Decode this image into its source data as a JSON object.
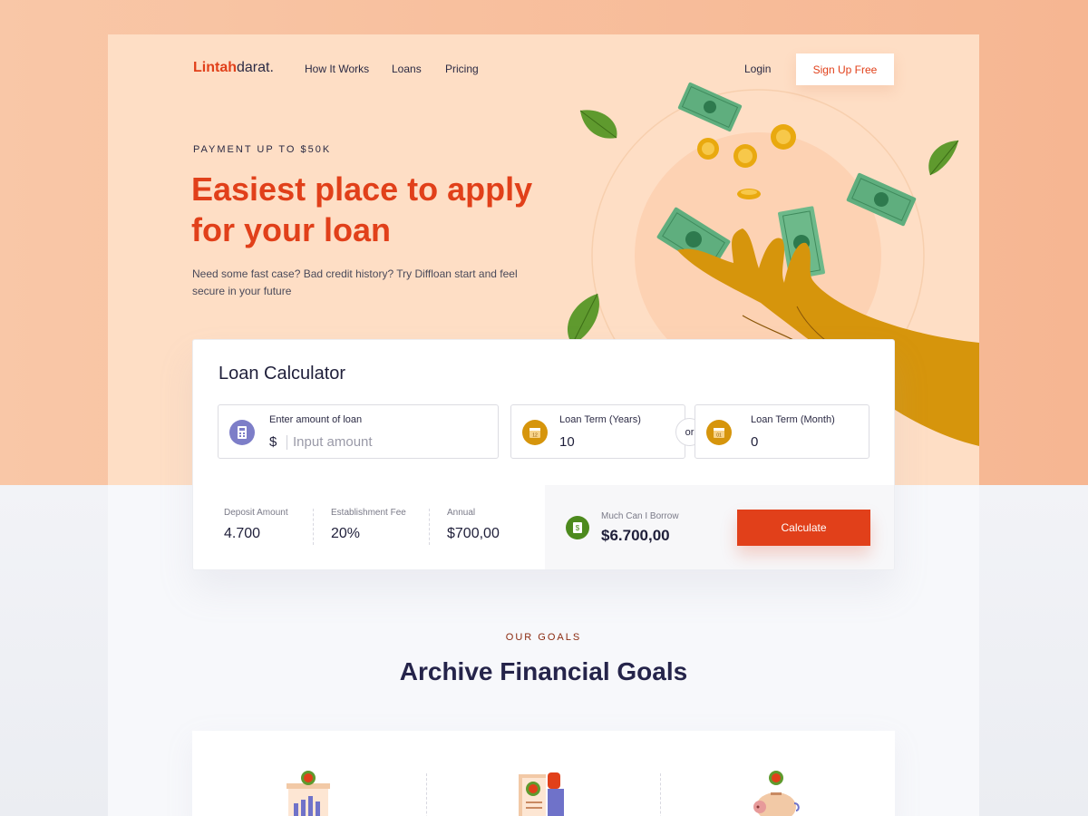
{
  "brand": {
    "first": "Lintah",
    "rest": "darat."
  },
  "nav": {
    "links": [
      "How It Works",
      "Loans",
      "Pricing"
    ],
    "login": "Login",
    "signup": "Sign Up Free"
  },
  "hero": {
    "eyebrow": "PAYMENT UP TO $50K",
    "headline_line1": "Easiest place to apply",
    "headline_line2": "for your loan",
    "subtitle": "Need some fast case? Bad credit history? Try Diffloan start and feel secure in your future"
  },
  "calculator": {
    "title": "Loan Calculator",
    "amount": {
      "label": "Enter amount of loan",
      "currency": "$",
      "placeholder": "Input amount"
    },
    "term_years": {
      "label": "Loan Term (Years)",
      "value": "10",
      "icon_text": "12"
    },
    "or": "or",
    "term_month": {
      "label": "Loan Term (Month)",
      "value": "0",
      "icon_text": "01"
    },
    "stats": [
      {
        "label": "Deposit Amount",
        "value": "4.700"
      },
      {
        "label": "Establishment Fee",
        "value": "20%"
      },
      {
        "label": "Annual",
        "value": "$700,00"
      }
    ],
    "borrow": {
      "label": "Much Can I Borrow",
      "value": "$6.700,00",
      "icon": "$"
    },
    "button": "Calculate"
  },
  "goals": {
    "eyebrow": "OUR GOALS",
    "title": "Archive Financial Goals",
    "icons": [
      "bank-chart-icon",
      "document-coin-icon",
      "piggy-bank-icon"
    ]
  },
  "colors": {
    "accent": "#e1401a",
    "hero_bg": "#fedec5",
    "dark_text": "#1f1f3a",
    "green": "#4d8a1e",
    "gold": "#d6950c"
  }
}
